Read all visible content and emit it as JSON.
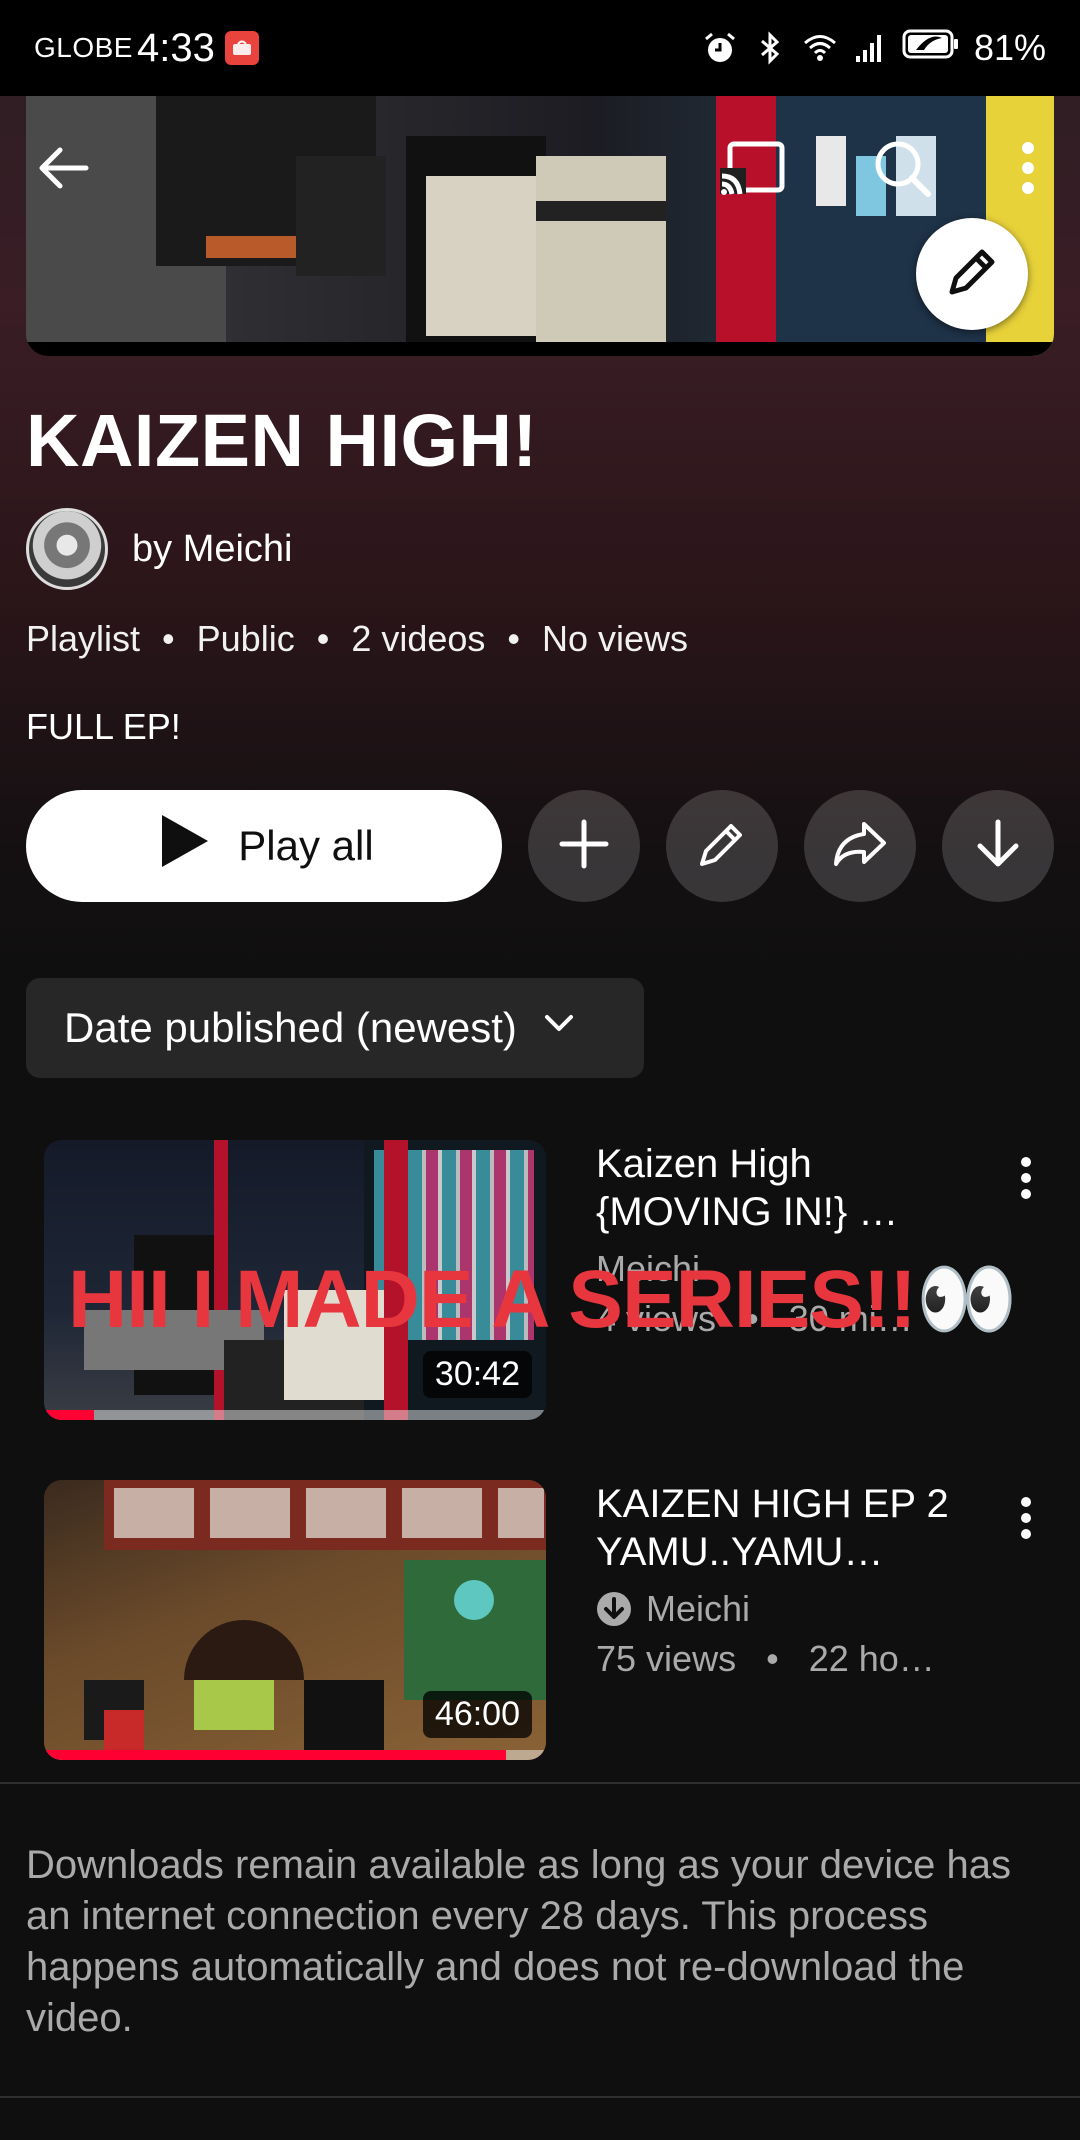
{
  "status_bar": {
    "carrier": "GLOBE",
    "time": "4:33",
    "battery": "81%"
  },
  "header": {
    "back_icon": "arrow-back-icon",
    "cast_icon": "cast-icon",
    "search_icon": "search-icon",
    "more_icon": "more-vert-icon",
    "edit_icon": "pencil-icon"
  },
  "playlist": {
    "title": "KAIZEN HIGH!",
    "owner": "by Meichi",
    "type": "Playlist",
    "visibility": "Public",
    "video_count": "2 videos",
    "views": "No views",
    "description": "FULL EP!"
  },
  "actions": {
    "play_all_label": "Play all",
    "buttons": [
      "add-icon",
      "pencil-icon",
      "share-icon",
      "download-icon"
    ]
  },
  "sort": {
    "label": "Date published (newest)"
  },
  "videos": [
    {
      "title": "Kaizen High {MOVING IN!} …",
      "channel": "Meichi",
      "views": "4 views",
      "age": "30 mi…",
      "duration": "30:42",
      "progress": 0.1,
      "downloaded": false
    },
    {
      "title": "KAIZEN HIGH EP 2 YAMU..YAMU…",
      "channel": "Meichi",
      "views": "75 views",
      "age": "22 ho…",
      "duration": "46:00",
      "progress": 0.92,
      "downloaded": true
    }
  ],
  "overlay_caption": "HII I MADE A SERIES!!👀",
  "downloads_note": "Downloads remain available as long as your device has an internet connection every 28 days. This process happens automatically and does not re-download the video.",
  "colors": {
    "accent_red": "#ff0033",
    "overlay_red": "#e8363f",
    "background": "#0f0f0f"
  }
}
